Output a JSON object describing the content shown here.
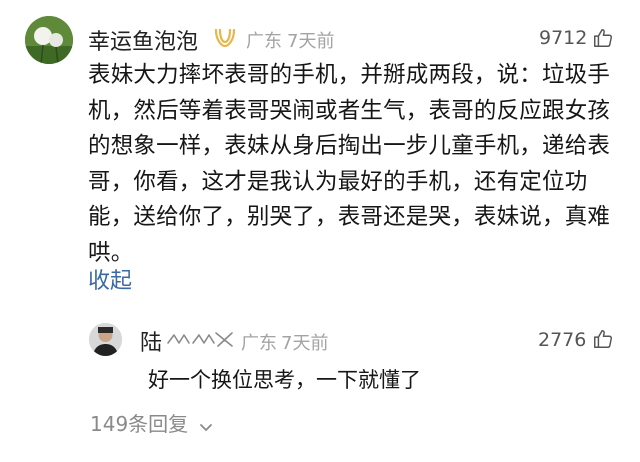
{
  "comment": {
    "username": "幸运鱼泡泡",
    "location": "广东",
    "time_ago": "7天前",
    "like_count": "9712",
    "text": "表妹大力摔坏表哥的手机，并掰成两段，说：垃圾手机，然后等着表哥哭闹或者生气，表哥的反应跟女孩的想象一样，表妹从身后掏出一步儿童手机，递给表哥，你看，这才是我认为最好的手机，还有定位功能，送给你了，别哭了，表哥还是哭，表妹说，真难哄。",
    "collapse_label": "收起"
  },
  "reply": {
    "username": "陆",
    "location": "广东",
    "time_ago": "7天前",
    "like_count": "2776",
    "text": "好一个换位思考，一下就懂了"
  },
  "footer": {
    "replies_label": "149条回复"
  },
  "colors": {
    "link": "#3a6aa6",
    "meta": "#a3a3a3",
    "badge": "#e8b64a"
  }
}
